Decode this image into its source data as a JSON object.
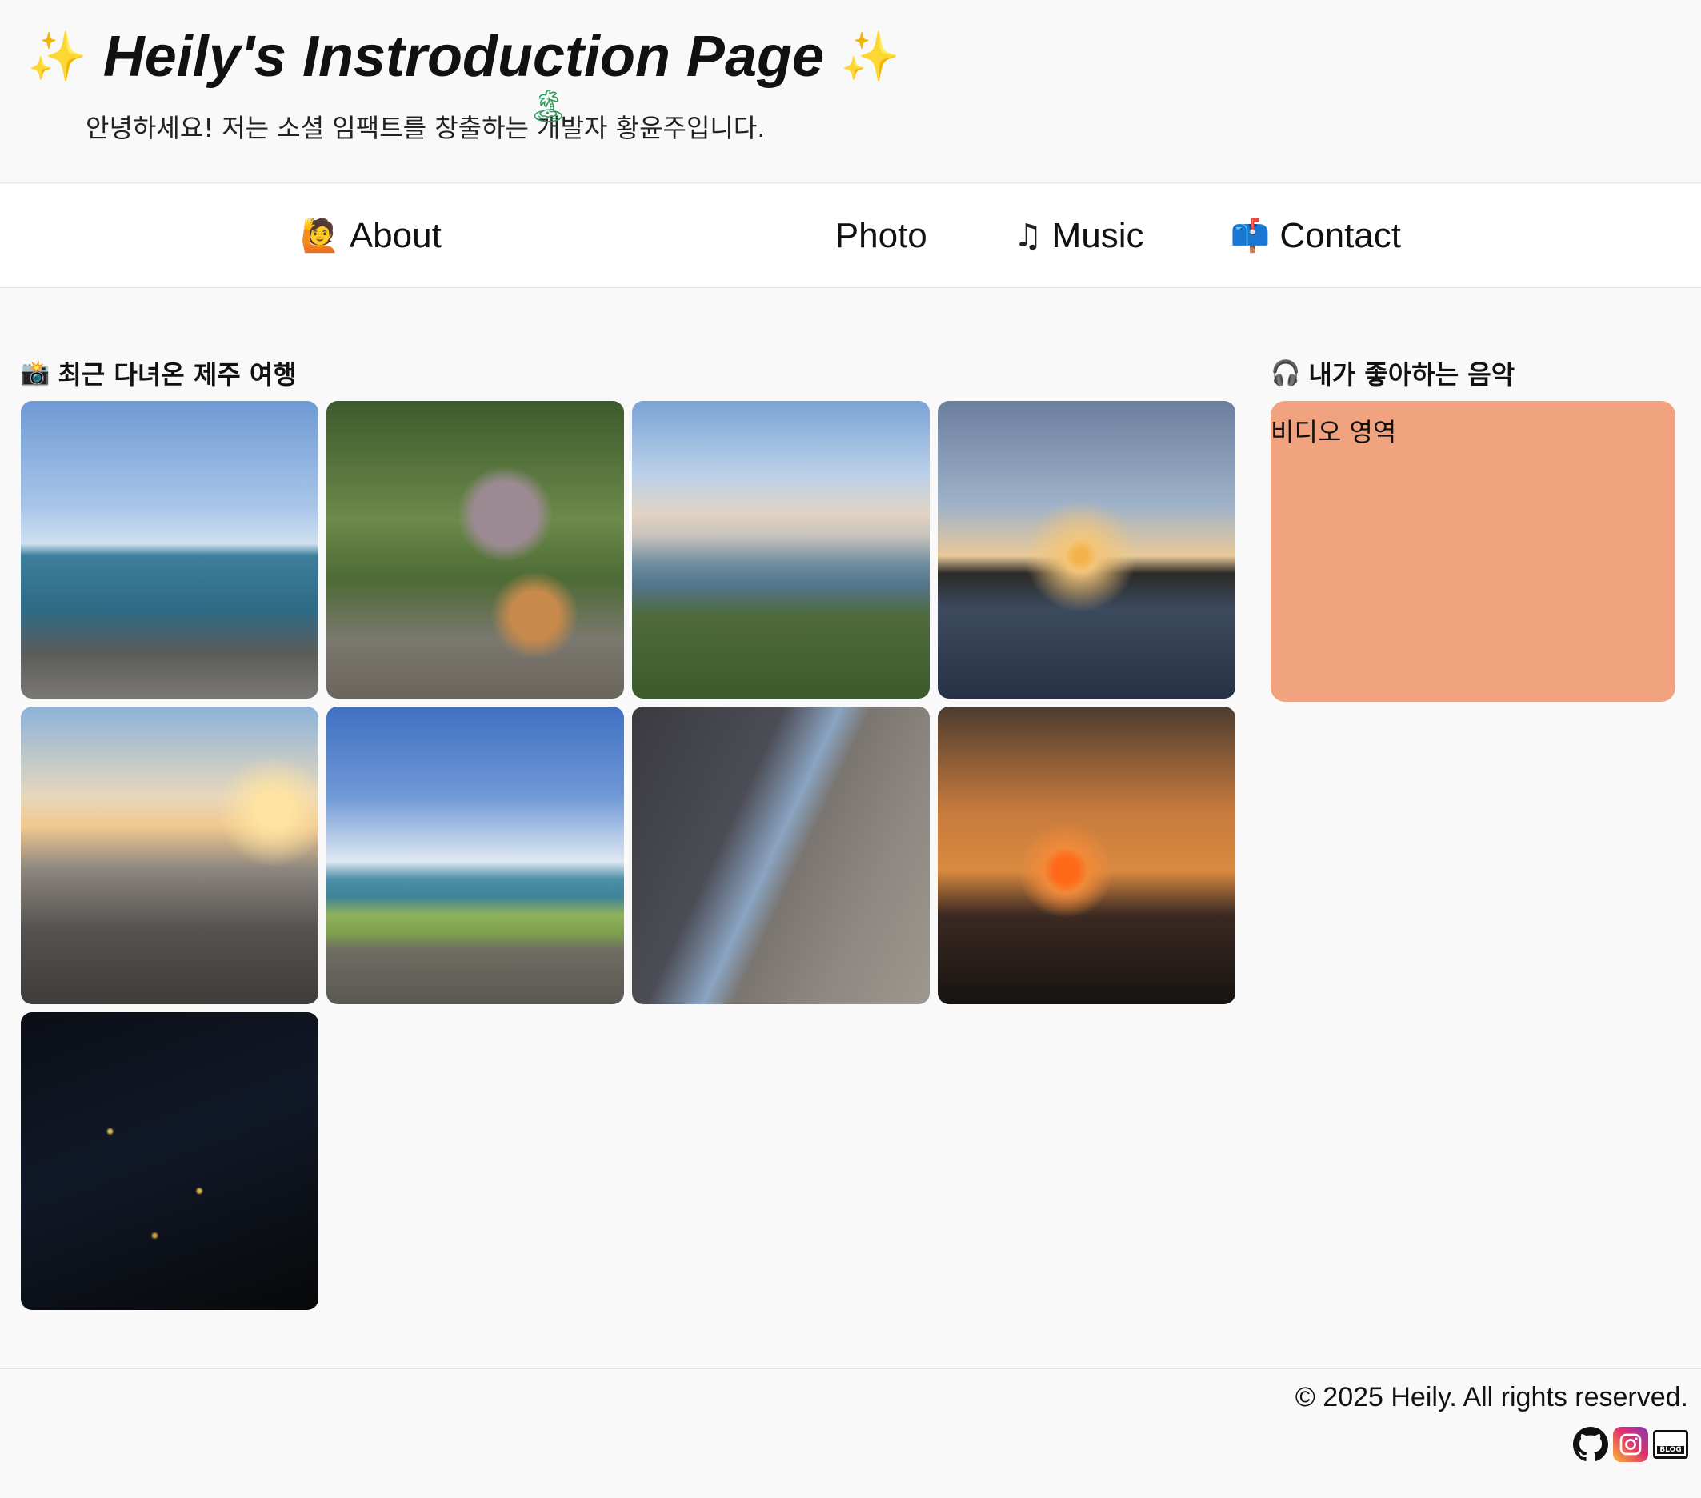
{
  "header": {
    "title": "Heily's Instroduction Page",
    "sparkle_icon": "sparkle-icon",
    "intro": "안녕하세요! 저는 소셜 임팩트를 창출하는 개발자 황윤주입니다."
  },
  "nav": {
    "items": [
      {
        "label": "About",
        "icon": "person-raising-hand-icon"
      },
      {
        "label": "Photo",
        "icon": "island-icon"
      },
      {
        "label": "Music",
        "icon": "music-note-icon"
      },
      {
        "label": "Contact",
        "icon": "mailbox-icon"
      }
    ]
  },
  "photos": {
    "heading": "최근 다녀온 제주 여행",
    "heading_icon": "camera-flash-icon",
    "count": 9
  },
  "music": {
    "heading": "내가 좋아하는 음악",
    "heading_icon": "headphones-icon",
    "placeholder": "비디오 영역",
    "box_color": "#f1a380"
  },
  "footer": {
    "copyright": "© 2025 Heily. All rights reserved.",
    "social": [
      "github-icon",
      "instagram-icon",
      "blog-icon"
    ],
    "blog_label": "BLOG"
  }
}
